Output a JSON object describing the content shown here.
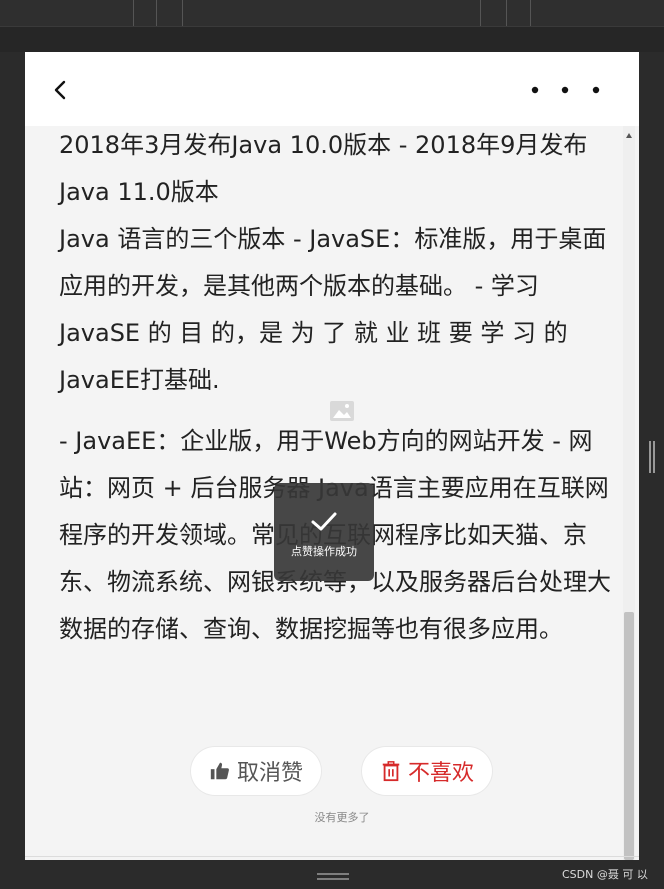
{
  "article": {
    "paragraphs": [
      "2018年3月发布Java 10.0版本 - 2018年9月发布Java 11.0版本",
      "Java 语言的三个版本 - JavaSE：标准版，用于桌面应用的开发，是其他两个版本的基础。 - 学习 JavaSE 的 目 的，是 为 了 就 业 班 要 学 习 的 JavaEE打基础.",
      "- JavaEE：企业版，用于Web方向的网站开发 - 网站：网页 + 后台服务器 Java语言主要应用在互联网程序的开发领域。常见的互联网程序比如天猫、京东、物流系统、网银系统等，以及服务器后台处理大数据的存储、查询、数据挖掘等也有很多应用。"
    ]
  },
  "actions": {
    "like_label": "取消赞",
    "dislike_label": "不喜欢"
  },
  "footer": {
    "no_more": "没有更多了"
  },
  "toast": {
    "message": "点赞操作成功"
  },
  "watermark": "CSDN @聂 可 以",
  "colors": {
    "accent_red": "#d62a2a",
    "toast_bg": "#373737"
  },
  "icons": {
    "back": "back-arrow-icon",
    "more": "more-dots-icon",
    "like": "thumbs-up-icon",
    "dislike": "trash-icon",
    "toast": "check-icon",
    "image": "image-placeholder-icon"
  }
}
